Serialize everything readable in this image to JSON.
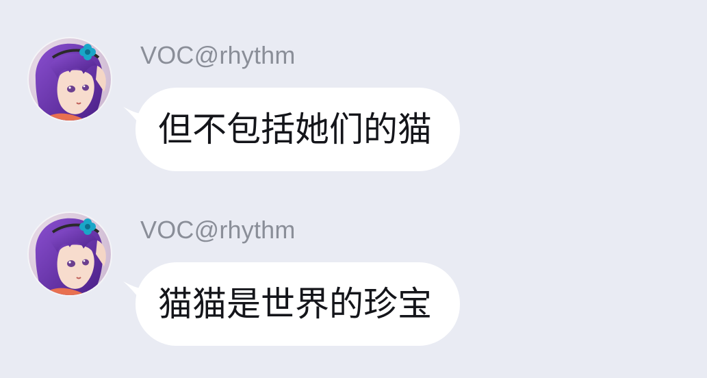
{
  "chat": {
    "messages": [
      {
        "sender": "VOC@rhythm",
        "text": "但不包括她们的猫",
        "avatar_icon": "anime-girl-avatar-icon"
      },
      {
        "sender": "VOC@rhythm",
        "text": "猫猫是世界的珍宝",
        "avatar_icon": "anime-girl-avatar-icon"
      }
    ]
  },
  "colors": {
    "background": "#e9ebf3",
    "bubble": "#ffffff",
    "sender_text": "#8a8e98",
    "message_text": "#14151a",
    "hair_purple": "#6b35a8",
    "flower_teal": "#1aa6c8"
  }
}
